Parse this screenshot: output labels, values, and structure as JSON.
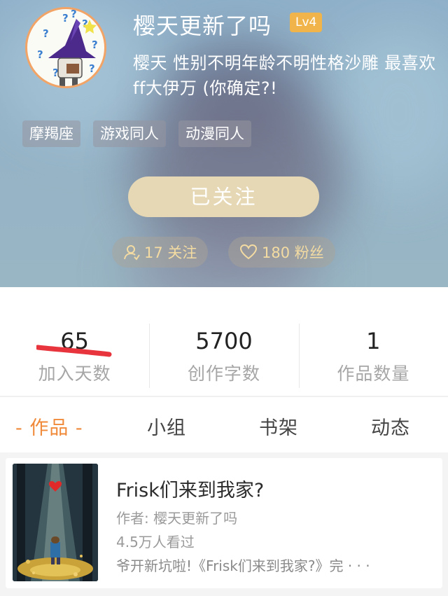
{
  "profile": {
    "username": "樱天更新了吗",
    "level": "Lv4",
    "bio": "樱天 性别不明年龄不明性格沙雕 最喜欢ff大伊万 (你确定?!",
    "tags": [
      "摩羯座",
      "游戏同人",
      "动漫同人"
    ],
    "follow_button": "已关注",
    "following": "17 关注",
    "fans": "180 粉丝"
  },
  "stats": [
    {
      "value": "65",
      "label": "加入天数"
    },
    {
      "value": "5700",
      "label": "创作字数"
    },
    {
      "value": "1",
      "label": "作品数量"
    }
  ],
  "tabs": {
    "active": "- 作品 -",
    "items": [
      "小组",
      "书架",
      "动态"
    ]
  },
  "work": {
    "title": "Frisk们来到我家?",
    "author": "作者: 樱天更新了吗",
    "views": "4.5万人看过",
    "summary": "爷开新坑啦!《Frisk们来到我家?》完 · · ·"
  },
  "colors": {
    "accent": "#f08a3a",
    "level_badge": "#f0b44a",
    "follow_button": "#e6d8b4",
    "scribble": "#e8343c"
  },
  "icons": {
    "following": "person-icon",
    "fans": "heart-icon"
  }
}
